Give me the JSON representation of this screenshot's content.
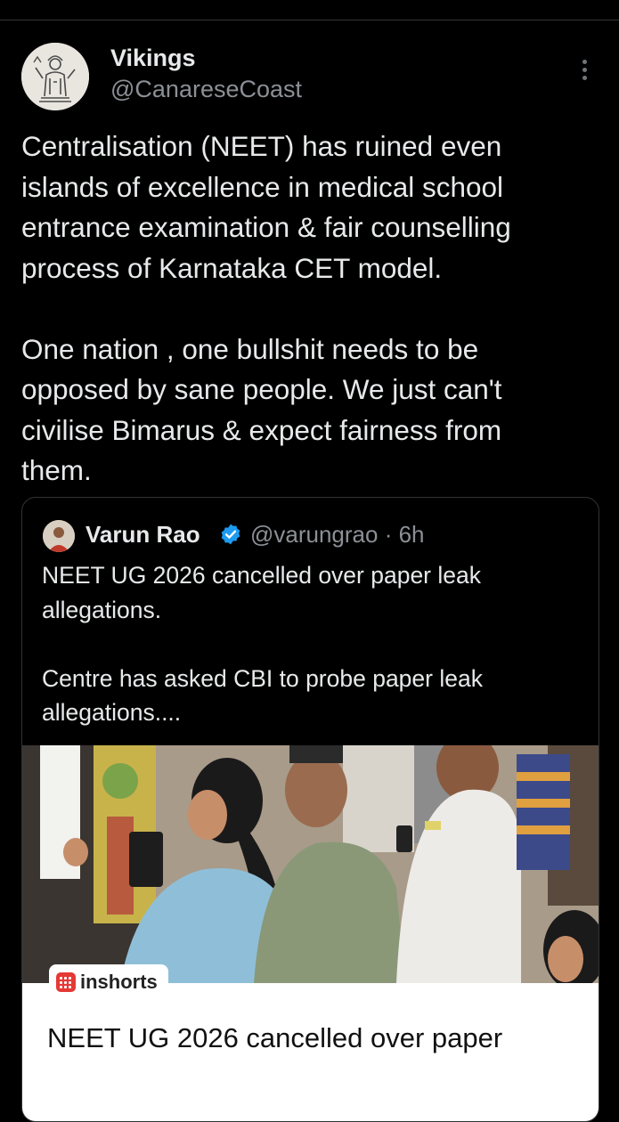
{
  "tweet": {
    "display_name": "Vikings",
    "handle": "@CanareseCoast",
    "text": "Centralisation (NEET) has ruined even\nislands of excellence in medical school\nentrance examination & fair counselling\nprocess of Karnataka CET model.\n\nOne nation , one bullshit needs to be\nopposed by sane people. We just can't\ncivilise Bimarus & expect fairness from\nthem."
  },
  "quoted_tweet": {
    "display_name": "Varun Rao",
    "handle": "@varungrao",
    "time": "· 6h",
    "text": "NEET UG 2026 cancelled over paper leak\nallegations.\n\nCentre has asked CBI to probe paper leak\nallegations...."
  },
  "link_card": {
    "source": "inshorts",
    "title": "NEET UG 2026 cancelled over paper"
  },
  "colors": {
    "background": "#000000",
    "text_primary": "#e7e9ea",
    "text_secondary": "#8b9096",
    "verified_blue": "#1d9bf0",
    "inshorts_red": "#e53935"
  },
  "icons": {
    "more": "more-vertical-icon",
    "verified": "verified-badge-icon",
    "source": "inshorts-logo-icon"
  }
}
